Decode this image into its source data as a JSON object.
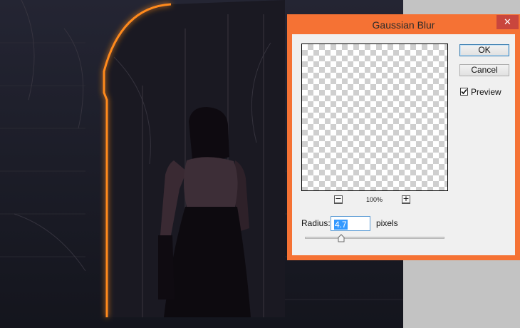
{
  "dialog": {
    "title": "Gaussian Blur",
    "close_glyph": "✕",
    "ok_label": "OK",
    "cancel_label": "Cancel",
    "preview_label": "Preview",
    "preview_checked": true,
    "zoom_out_glyph": "−",
    "zoom_in_glyph": "+",
    "zoom_level": "100%",
    "radius_label": "Radius:",
    "radius_value": "4.7",
    "radius_unit": "pixels",
    "radius_slider_fraction": 0.26
  },
  "colors": {
    "dialog_frame": "#f57234",
    "close_button": "#c9463d",
    "neon_glow": "#ff8a1e",
    "selection": "#3399ff"
  },
  "icons": {
    "close": "close-icon",
    "check": "check-icon",
    "zoom_out": "minus-icon",
    "zoom_in": "plus-icon",
    "slider": "triangle-thumb-icon"
  }
}
